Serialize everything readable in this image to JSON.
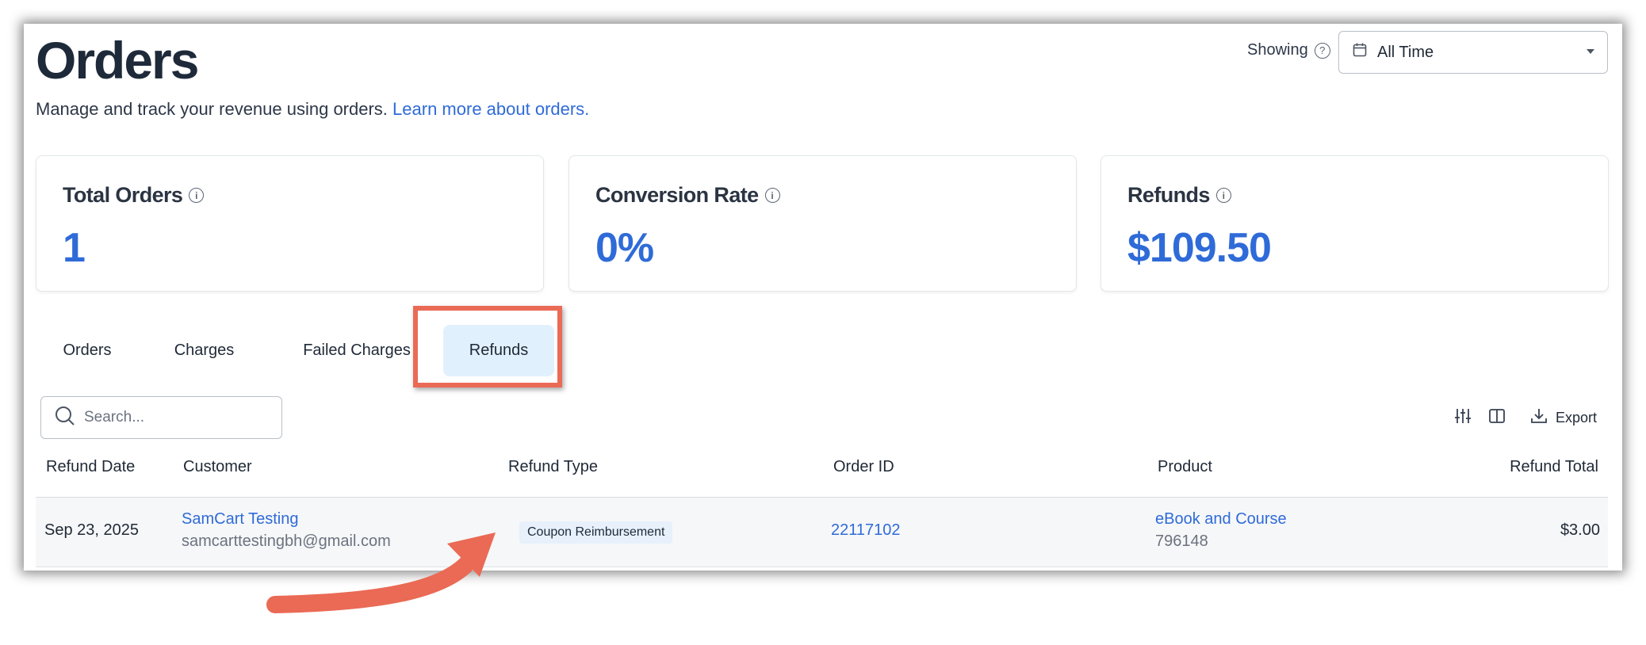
{
  "page": {
    "title": "Orders",
    "subtitle": "Manage and track your revenue using orders.",
    "learn_more": "Learn more about orders."
  },
  "filter": {
    "showing_label": "Showing",
    "help_glyph": "?",
    "date_range": "All Time"
  },
  "stats": [
    {
      "label": "Total Orders",
      "value": "1"
    },
    {
      "label": "Conversion Rate",
      "value": "0%"
    },
    {
      "label": "Refunds",
      "value": "$109.50"
    }
  ],
  "info_glyph": "i",
  "tabs": [
    {
      "label": "Orders",
      "active": false
    },
    {
      "label": "Charges",
      "active": false
    },
    {
      "label": "Failed Charges",
      "active": false
    },
    {
      "label": "Refunds",
      "active": true
    }
  ],
  "search": {
    "placeholder": "Search..."
  },
  "toolbar": {
    "export_label": "Export"
  },
  "table": {
    "columns": [
      "Refund Date",
      "Customer",
      "Refund Type",
      "Order ID",
      "Product",
      "Refund Total"
    ],
    "rows": [
      {
        "refund_date": "Sep 23, 2025",
        "customer_name": "SamCart Testing",
        "customer_email": "samcarttestingbh@gmail.com",
        "refund_type": "Coupon Reimbursement",
        "order_id": "22117102",
        "product_name": "eBook and Course",
        "product_id": "796148",
        "refund_total": "$3.00"
      }
    ]
  },
  "colors": {
    "accent_blue": "#2f6bd8",
    "active_tab_bg": "#e1f0fd",
    "annotation": "#ea6a55",
    "heading": "#1e2a3a"
  },
  "icons": [
    "help-circle-icon",
    "calendar-icon",
    "chevron-down-icon",
    "info-icon",
    "search-icon",
    "sliders-icon",
    "columns-icon",
    "download-icon",
    "arrow-annotation"
  ]
}
